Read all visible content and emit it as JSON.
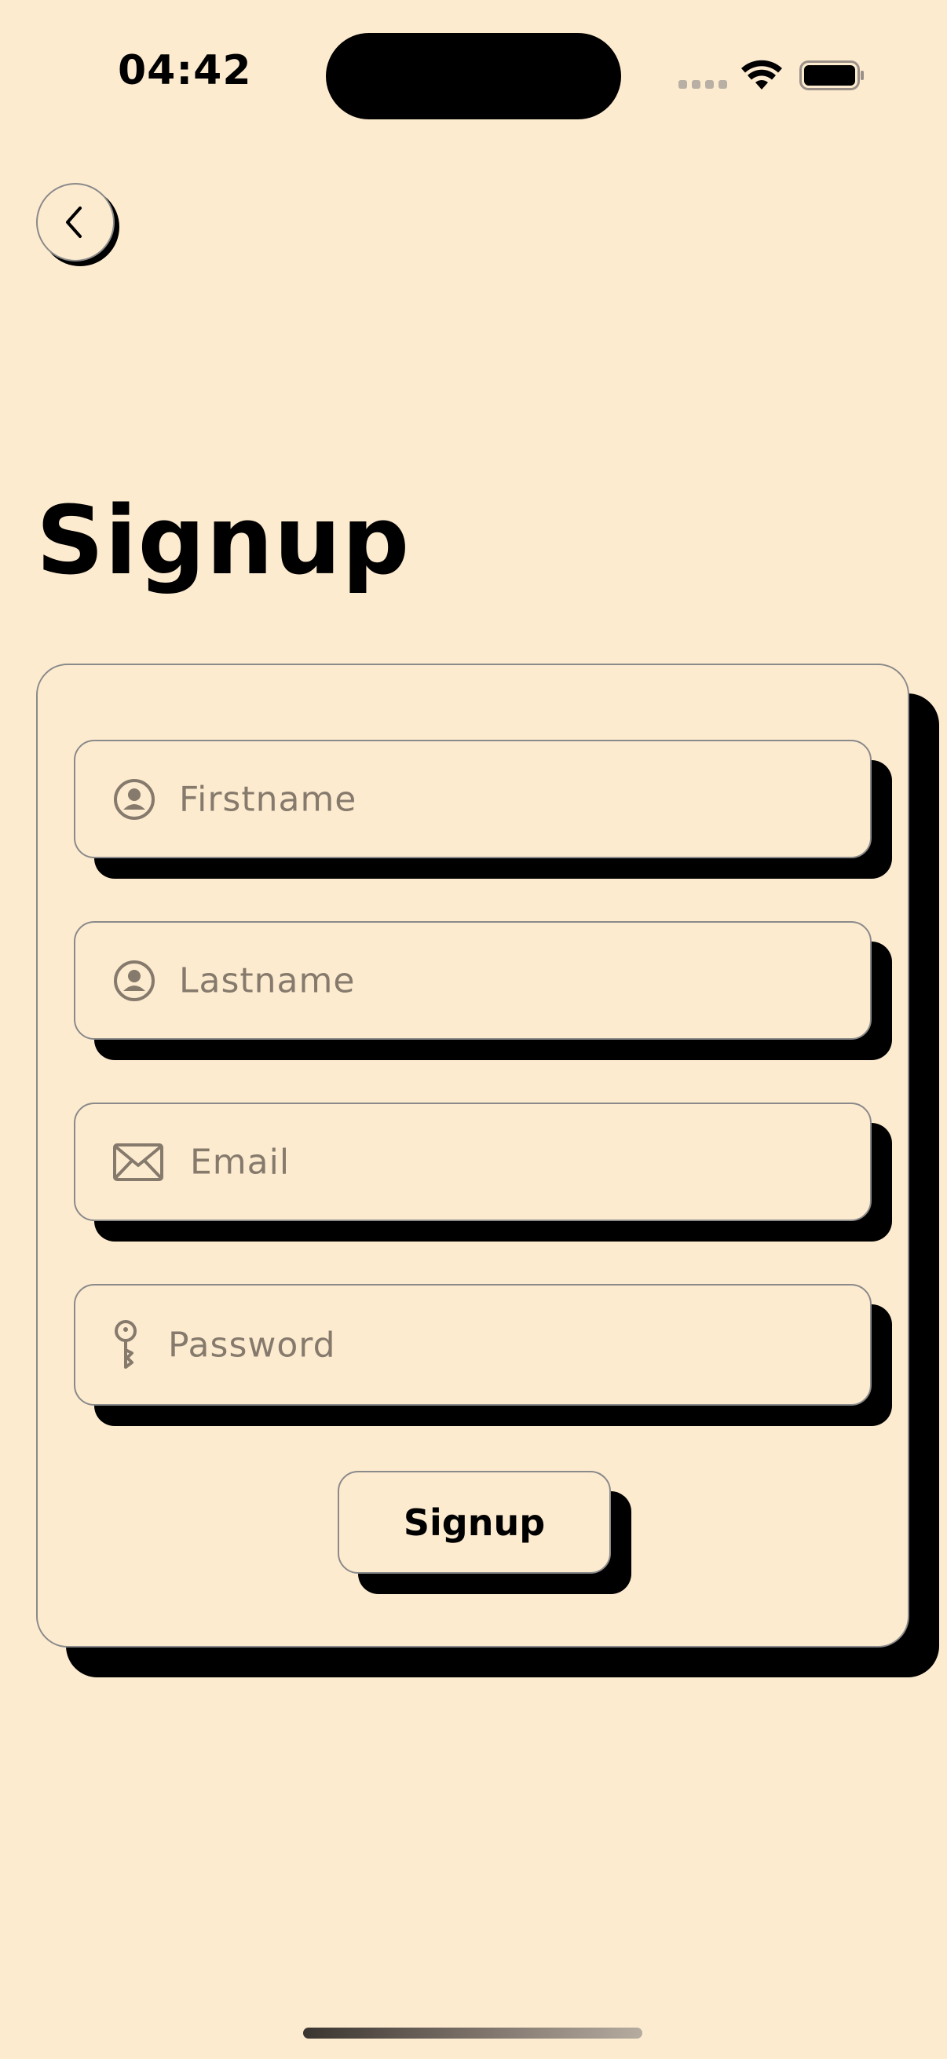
{
  "status_bar": {
    "time": "04:42",
    "icons": [
      "cellular-signal-icon",
      "wifi-icon",
      "battery-icon"
    ]
  },
  "navigation": {
    "back_icon": "chevron-left-icon"
  },
  "page": {
    "title": "Signup"
  },
  "form": {
    "fields": [
      {
        "name": "firstname",
        "placeholder": "Firstname",
        "icon": "user-circle-icon",
        "value": ""
      },
      {
        "name": "lastname",
        "placeholder": "Lastname",
        "icon": "user-circle-icon",
        "value": ""
      },
      {
        "name": "email",
        "placeholder": "Email",
        "icon": "envelope-icon",
        "value": ""
      },
      {
        "name": "password",
        "placeholder": "Password",
        "icon": "key-icon",
        "value": ""
      }
    ],
    "submit_label": "Signup"
  },
  "colors": {
    "background": "#fdebd0",
    "shadow": "#000000",
    "border": "#8a8a8a",
    "placeholder": "#857a6c",
    "text": "#000000"
  }
}
